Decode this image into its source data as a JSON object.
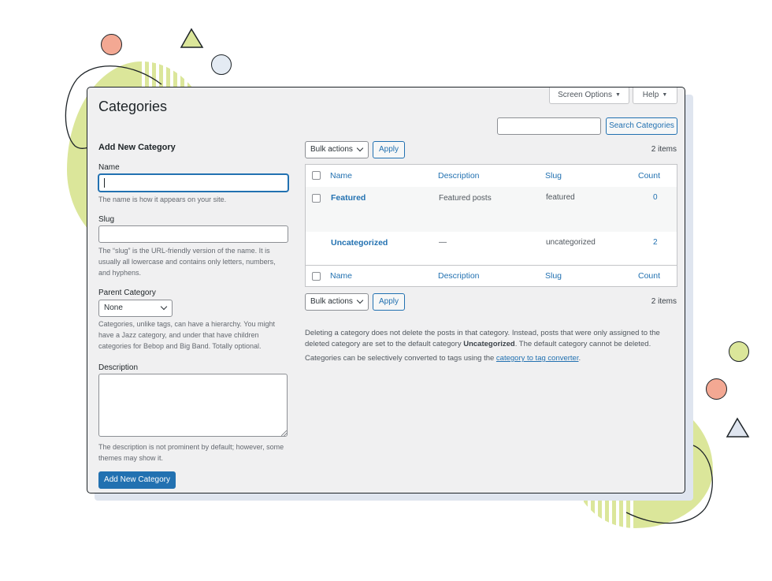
{
  "page": {
    "title": "Categories"
  },
  "header": {
    "screen_options_label": "Screen Options",
    "help_label": "Help",
    "search_value": "",
    "search_button": "Search Categories"
  },
  "form": {
    "heading": "Add New Category",
    "name": {
      "label": "Name",
      "value": "",
      "help": "The name is how it appears on your site."
    },
    "slug": {
      "label": "Slug",
      "value": "",
      "help": "The “slug” is the URL-friendly version of the name. It is usually all lowercase and contains only letters, numbers, and hyphens."
    },
    "parent": {
      "label": "Parent Category",
      "selected": "None",
      "help": "Categories, unlike tags, can have a hierarchy. You might have a Jazz category, and under that have children categories for Bebop and Big Band. Totally optional."
    },
    "description": {
      "label": "Description",
      "value": "",
      "help": "The description is not prominent by default; however, some themes may show it."
    },
    "submit_label": "Add New Category"
  },
  "list": {
    "bulk_actions_label": "Bulk actions",
    "apply_label": "Apply",
    "items_count": "2 items",
    "columns": {
      "name": "Name",
      "description": "Description",
      "slug": "Slug",
      "count": "Count"
    },
    "rows": [
      {
        "name": "Featured",
        "description": "Featured posts",
        "slug": "featured",
        "count": "0"
      },
      {
        "name": "Uncategorized",
        "description": "—",
        "slug": "uncategorized",
        "count": "2"
      }
    ]
  },
  "notes": {
    "delete_note_pre": "Deleting a category does not delete the posts in that category. Instead, posts that were only assigned to the deleted category are set to the default category ",
    "delete_note_bold": "Uncategorized",
    "delete_note_post": ". The default category cannot be deleted.",
    "convert_pre": "Categories can be selectively converted to tags using the ",
    "convert_link": "category to tag converter",
    "convert_post": "."
  },
  "colors": {
    "accent": "#2271b1",
    "panel_bg": "#f0f0f1",
    "decor_lime": "#dbe69a",
    "decor_salmon": "#f3a893"
  }
}
